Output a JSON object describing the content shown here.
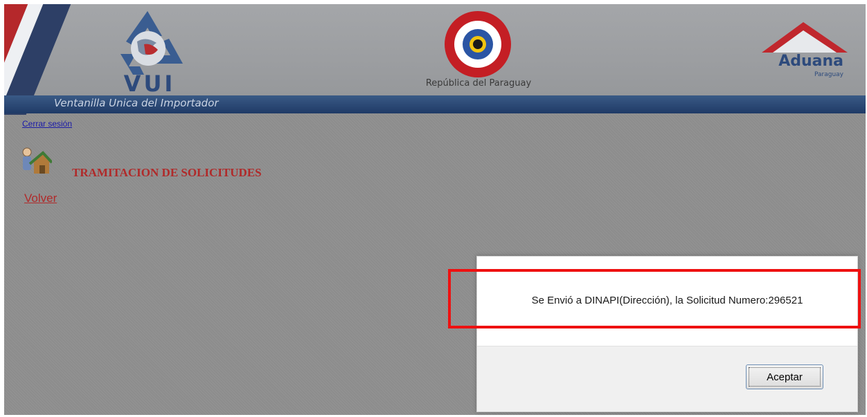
{
  "header": {
    "vui_logo_text": "VUI",
    "republica_text": "República del Paraguay",
    "aduana_name": "Aduana",
    "aduana_country": "Paraguay",
    "tagline": "Ventanilla Unica del Importador"
  },
  "nav": {
    "logout_label": "Cerrar sesión"
  },
  "section": {
    "title": "TRAMITACION DE SOLICITUDES",
    "back_label": "Volver"
  },
  "dialog": {
    "message": "Se Envió a DINAPI(Dirección), la Solicitud Numero:296521",
    "accept_label": "Aceptar"
  },
  "colors": {
    "brand_blue": "#2d4a7c",
    "title_red": "#b02a2a",
    "highlight_red": "#ee1111"
  },
  "icons": [
    "vui-recycle-icon",
    "paraguay-seal-icon",
    "aduana-roof-icon",
    "user-house-icon"
  ]
}
